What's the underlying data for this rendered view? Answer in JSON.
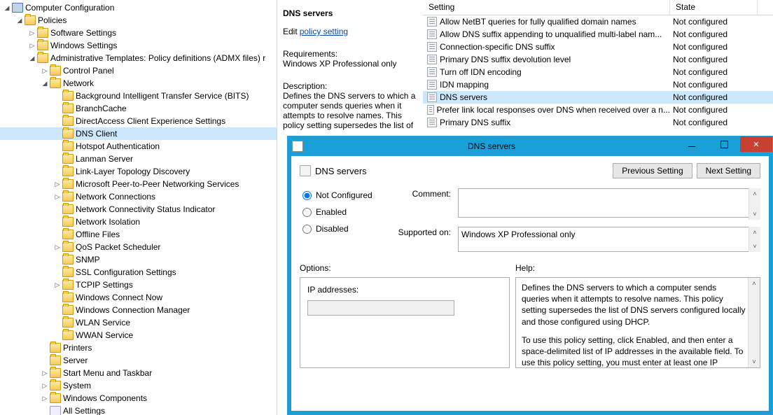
{
  "tree": {
    "rootLabel": "Computer Configuration",
    "policies": "Policies",
    "software": "Software Settings",
    "windows": "Windows Settings",
    "admtempl": "Administrative Templates: Policy definitions (ADMX files) r",
    "controlpanel": "Control Panel",
    "network": "Network",
    "netchildren": [
      "Background Intelligent Transfer Service (BITS)",
      "BranchCache",
      "DirectAccess Client Experience Settings",
      "DNS Client",
      "Hotspot Authentication",
      "Lanman Server",
      "Link-Layer Topology Discovery",
      "Microsoft Peer-to-Peer Networking Services",
      "Network Connections",
      "Network Connectivity Status Indicator",
      "Network Isolation",
      "Offline Files",
      "QoS Packet Scheduler",
      "SNMP",
      "SSL Configuration Settings",
      "TCPIP Settings",
      "Windows Connect Now",
      "Windows Connection Manager",
      "WLAN Service",
      "WWAN Service"
    ],
    "printers": "Printers",
    "server": "Server",
    "startmenu": "Start Menu and Taskbar",
    "system": "System",
    "wincomp": "Windows Components",
    "allsettings": "All Settings"
  },
  "mid": {
    "title": "DNS servers",
    "editLabel": "Edit",
    "editLink": "policy setting",
    "reqHdr": "Requirements:",
    "reqTxt": "Windows XP Professional only",
    "descHdr": "Description:",
    "descTxt": "Defines the DNS servers to which a computer sends queries when it attempts to resolve names. This policy setting supersedes the list of"
  },
  "grid": {
    "colSetting": "Setting",
    "colState": "State",
    "rows": [
      {
        "name": "Allow NetBT queries for fully qualified domain names",
        "state": "Not configured"
      },
      {
        "name": "Allow DNS suffix appending to unqualified multi-label nam...",
        "state": "Not configured"
      },
      {
        "name": "Connection-specific DNS suffix",
        "state": "Not configured"
      },
      {
        "name": "Primary DNS suffix devolution level",
        "state": "Not configured"
      },
      {
        "name": "Turn off IDN encoding",
        "state": "Not configured"
      },
      {
        "name": "IDN mapping",
        "state": "Not configured"
      },
      {
        "name": "DNS servers",
        "state": "Not configured"
      },
      {
        "name": "Prefer link local responses over DNS when received over a n...",
        "state": "Not configured"
      },
      {
        "name": "Primary DNS suffix",
        "state": "Not configured"
      }
    ],
    "selectedIndex": 6
  },
  "dialog": {
    "title": "DNS servers",
    "heading": "DNS servers",
    "prevBtn": "Previous Setting",
    "nextBtn": "Next Setting",
    "radioNotConfigured": "Not Configured",
    "radioEnabled": "Enabled",
    "radioDisabled": "Disabled",
    "commentLabel": "Comment:",
    "supportedLabel": "Supported on:",
    "supportedTxt": "Windows XP Professional only",
    "optionsLabel": "Options:",
    "helpLabel": "Help:",
    "ipLabel": "IP addresses:",
    "helpP1": "Defines the DNS servers to which a computer sends queries when it attempts to resolve names. This policy setting supersedes the list of DNS servers configured locally and those configured using DHCP.",
    "helpP2": "To use this policy setting, click Enabled, and then enter a space-delimited list of IP addresses in the available field. To use this policy setting, you must enter at least one IP address."
  }
}
